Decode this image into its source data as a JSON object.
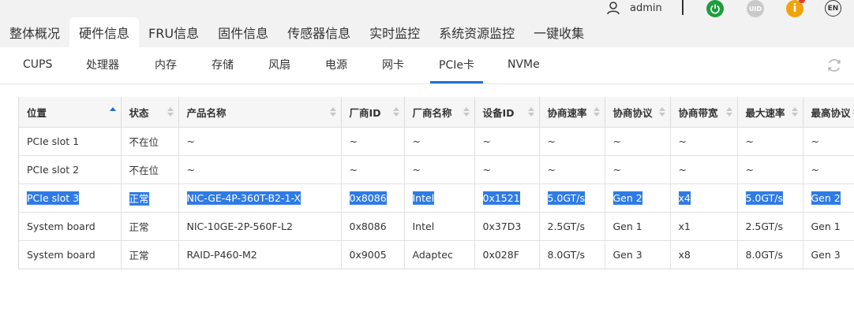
{
  "header": {
    "username": "admin",
    "uid_label": "UID",
    "info_label": "i",
    "lang_label": "EN"
  },
  "main_tabs": [
    "整体概况",
    "硬件信息",
    "FRU信息",
    "固件信息",
    "传感器信息",
    "实时监控",
    "系统资源监控",
    "一键收集"
  ],
  "sub_tabs": [
    "CUPS",
    "处理器",
    "内存",
    "存储",
    "风扇",
    "电源",
    "网卡",
    "PCIe卡",
    "NVMe"
  ],
  "table": {
    "columns": [
      "位置",
      "状态",
      "产品名称",
      "厂商ID",
      "厂商名称",
      "设备ID",
      "协商速率",
      "协商协议",
      "协商带宽",
      "最大速率",
      "最高协议"
    ],
    "rows": [
      [
        "PCIe slot 1",
        "不在位",
        "~",
        "~",
        "~",
        "~",
        "~",
        "~",
        "~",
        "~",
        "~"
      ],
      [
        "PCIe slot 2",
        "不在位",
        "~",
        "~",
        "~",
        "~",
        "~",
        "~",
        "~",
        "~",
        "~"
      ],
      [
        "PCIe slot 3",
        "正常",
        "NIC-GE-4P-360T-B2-1-X",
        "0x8086",
        "Intel",
        "0x1521",
        "5.0GT/s",
        "Gen 2",
        "x4",
        "5.0GT/s",
        "Gen 2"
      ],
      [
        "System board",
        "正常",
        "NIC-10GE-2P-560F-L2",
        "0x8086",
        "Intel",
        "0x37D3",
        "2.5GT/s",
        "Gen 1",
        "x1",
        "2.5GT/s",
        "Gen 1"
      ],
      [
        "System board",
        "正常",
        "RAID-P460-M2",
        "0x9005",
        "Adaptec",
        "0x028F",
        "8.0GT/s",
        "Gen 3",
        "x8",
        "8.0GT/s",
        "Gen 3"
      ]
    ]
  },
  "colors": {
    "accent": "#1f6fd6",
    "selection": "#2f7be5",
    "power_green": "#1e9e3e",
    "warning_orange": "#f0a30a",
    "alert_red": "#e53935"
  },
  "icons": [
    "user-icon",
    "power-icon",
    "uid-icon",
    "info-icon",
    "language-icon",
    "refresh-icon",
    "sort-icon"
  ]
}
